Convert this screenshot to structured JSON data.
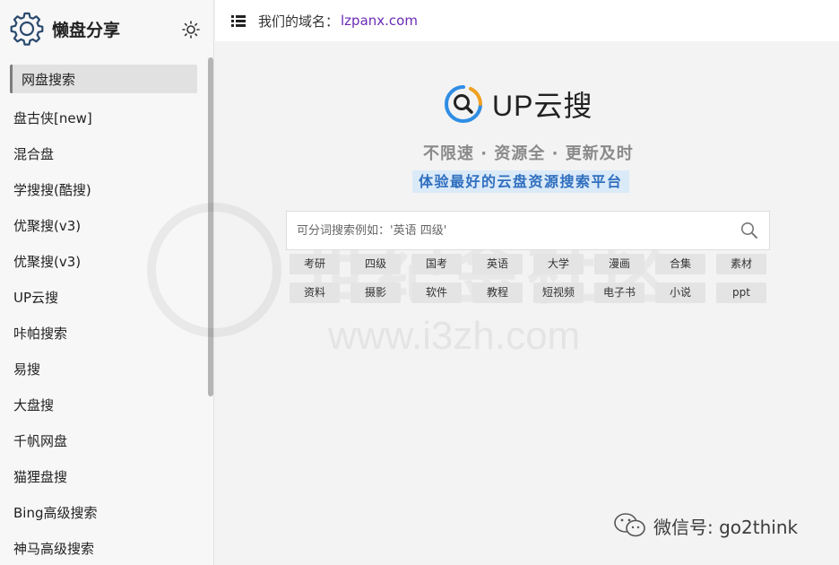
{
  "sidebar": {
    "title": "懒盘分享",
    "active_item": "网盘搜索",
    "items": [
      "盘古侠[new]",
      "混合盘",
      "学搜搜(酷搜)",
      "优聚搜(v3)",
      "优聚搜(v3)",
      "UP云搜",
      "咔帕搜索",
      "易搜",
      "大盘搜",
      "千帆网盘",
      "猫狸盘搜",
      "Bing高级搜索",
      "神马高级搜索"
    ]
  },
  "header": {
    "domain_label": "我们的域名：",
    "domain": "lzpanx.com"
  },
  "main": {
    "logo_text": "UP云搜",
    "tagline": "不限速 · 资源全 · 更新及时",
    "slogan": "体验最好的云盘资源搜索平台",
    "search": {
      "placeholder": "可分词搜索例如：'英语 四级'",
      "value": ""
    },
    "tags": [
      "考研",
      "四级",
      "国考",
      "英语",
      "大学",
      "漫画",
      "合集",
      "素材",
      "资料",
      "摄影",
      "软件",
      "教程",
      "短视频",
      "电子书",
      "小说",
      "ppt"
    ]
  },
  "watermark": {
    "cn": "世纪金社区",
    "url": "www.i3zh.com"
  },
  "wechat_mark": "微信号: go2think",
  "colors": {
    "link": "#6a2bb5",
    "logo_blue": "#2f8de4",
    "slogan_bg": "#dbeaf8",
    "slogan_text": "#2f6fbf"
  },
  "icons": {
    "brand": "gear-icon",
    "theme": "sun-icon",
    "header": "list-icon",
    "search": "magnifier-icon",
    "logo": "magnifier-logo-icon",
    "wechat": "wechat-icon"
  }
}
